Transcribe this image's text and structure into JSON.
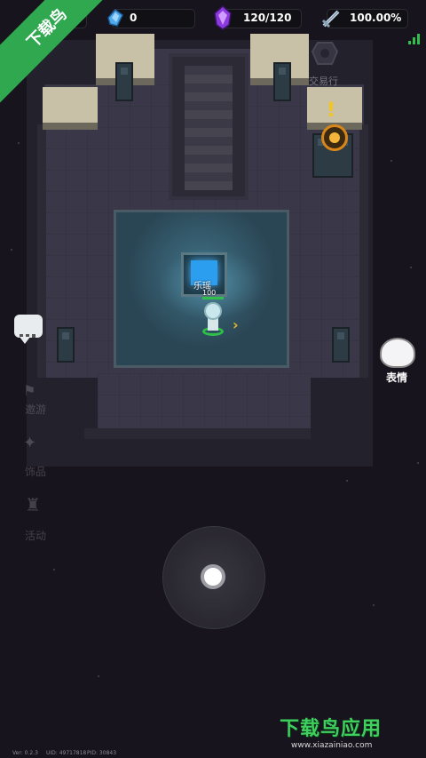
{
  "hud": {
    "gems": "0",
    "energy": "120/120",
    "attack_rate": "100.00%"
  },
  "banner": {
    "text": "下载鸟"
  },
  "npc": {
    "trade_label": "交易行"
  },
  "character": {
    "name": "乐瑶",
    "hp": "100"
  },
  "side_menu": {
    "item1": "邀游",
    "item2": "饰品",
    "item3": "活动"
  },
  "emote": {
    "label": "表情"
  },
  "footer": {
    "version": "Ver: 0.2.3",
    "uid": "UID: 49717818",
    "pid": "PID: 30843"
  },
  "watermark": {
    "brand": "下载鸟应用",
    "url": "www.xiazainiao.com"
  },
  "colors": {
    "accent_green": "#2fa84f",
    "portal_blue": "#2b9ef0",
    "highlight_gold": "#f5c518"
  }
}
